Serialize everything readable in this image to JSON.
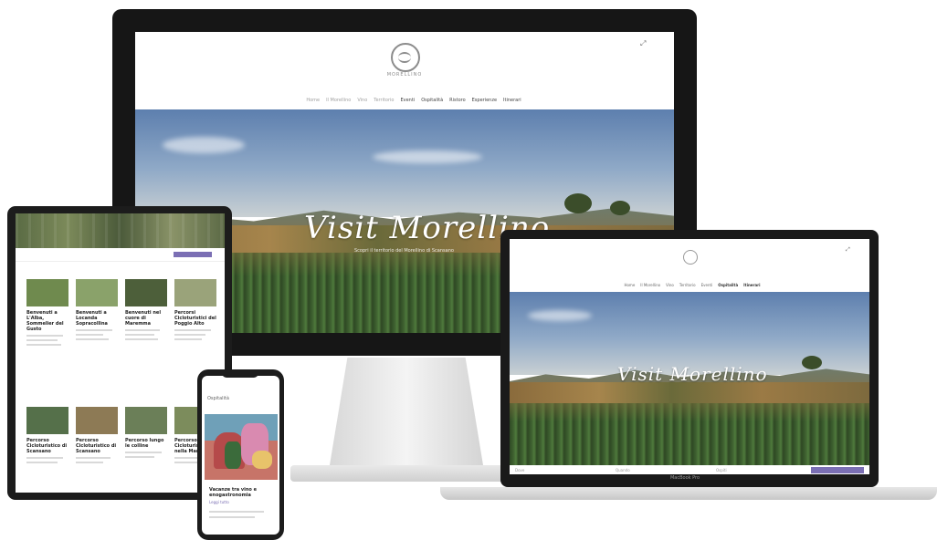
{
  "monitor": {
    "brand": "MORELLINO",
    "nav": [
      {
        "label": "Home",
        "dim": true
      },
      {
        "label": "Il Morellino",
        "dim": true
      },
      {
        "label": "Vino",
        "dim": true
      },
      {
        "label": "Territorio",
        "dim": true
      },
      {
        "label": "Eventi",
        "dim": false
      },
      {
        "label": "Ospitalità",
        "dim": false
      },
      {
        "label": "Ristoro",
        "dim": false
      },
      {
        "label": "Esperienze",
        "dim": false
      },
      {
        "label": "Itinerari",
        "dim": false
      }
    ],
    "hero_title": "Visit Morellino",
    "hero_subtitle": "Scopri il territorio del Morellino di Scansano"
  },
  "laptop": {
    "nav": [
      {
        "label": "Home",
        "hl": false
      },
      {
        "label": "Il Morellino",
        "hl": false
      },
      {
        "label": "Vino",
        "hl": false
      },
      {
        "label": "Territorio",
        "hl": false
      },
      {
        "label": "Eventi",
        "hl": false
      },
      {
        "label": "Ospitalità",
        "hl": true
      },
      {
        "label": "Itinerari",
        "hl": true
      }
    ],
    "hero_title": "Visit Morellino",
    "search_fields": [
      "Dove",
      "Quando",
      "Ospiti"
    ],
    "device_label": "MacBook Pro"
  },
  "tablet": {
    "cards_row1": [
      {
        "title": "Benvenuti a L'Alba, Sommelier del Gusto",
        "thumb": "#6f8a4e"
      },
      {
        "title": "Benvenuti a Locanda Sopracollina",
        "thumb": "#8aa26a"
      },
      {
        "title": "Benvenuti nel cuore di Maremma",
        "thumb": "#4d5f3a"
      },
      {
        "title": "Percorsi Cicloturistici del Poggio Alto",
        "thumb": "#9aa37a"
      }
    ],
    "cards_row2": [
      {
        "title": "Percorso Cicloturistico di Scansano",
        "thumb": "#55704a"
      },
      {
        "title": "Percorso Cicloturistico di Scansano",
        "thumb": "#8d7a55"
      },
      {
        "title": "Percorso lungo le colline",
        "thumb": "#6b7f58"
      },
      {
        "title": "Percorso Cicloturistico nella Maremma",
        "thumb": "#7c8c5c"
      }
    ]
  },
  "phone": {
    "header": "Ospitalità",
    "post_title": "Vacanze tra vino e enogastronomia",
    "post_link": "Leggi tutto"
  }
}
